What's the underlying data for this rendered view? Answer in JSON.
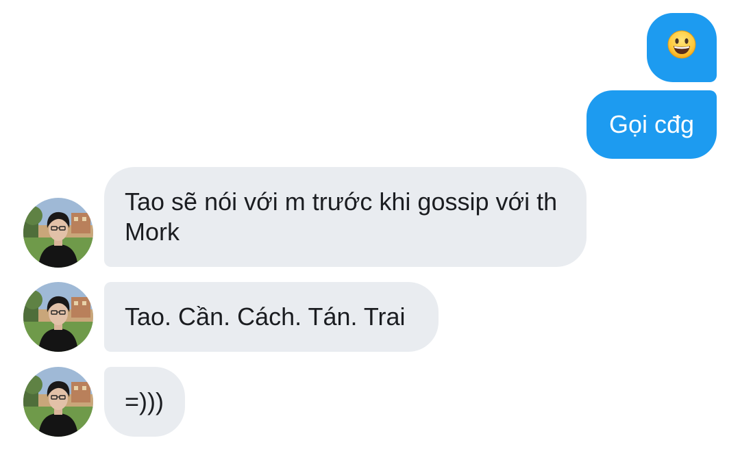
{
  "conversation": {
    "outgoing": [
      {
        "type": "emoji",
        "emoji": "😀",
        "icon": "grinning-face-icon"
      },
      {
        "type": "text",
        "text": "Gọi cđg"
      }
    ],
    "incoming": [
      {
        "text": "Tao sẽ nói với m trước khi gossip với th Mork"
      },
      {
        "text": "Tao. Cần. Cách. Tán. Trai"
      },
      {
        "text": "=)))"
      }
    ]
  },
  "colors": {
    "outgoing_bubble": "#1d9bf0",
    "incoming_bubble": "#e9ecf0",
    "incoming_text": "#1b1d21"
  }
}
